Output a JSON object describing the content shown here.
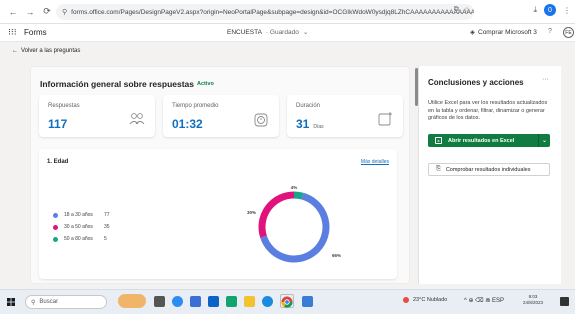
{
  "browser": {
    "back": "←",
    "forward": "→",
    "reload": "⟳",
    "url": "forms.office.com/Pages/DesignPageV2.aspx?origin=NeoPortalPage&subpage=design&id=OCGIkWdoW0ysdjq8LZhCAAAAAAAAAAAAAAAAAAAAAAAAAAAAAAAAAAZAAMKuKHUMzVCSVo0SElz...",
    "profile_initial": "0"
  },
  "app": {
    "name": "Forms",
    "survey_name": "ENCUESTA",
    "save_state": "· Guardado",
    "buy_label": "Comprar Microsoft 3",
    "help": "?",
    "avatar": "FE"
  },
  "back_link": "Volver a las preguntas",
  "overview": {
    "title": "Información general sobre respuestas",
    "status": "Activo",
    "stats": [
      {
        "label": "Respuestas",
        "value": "117",
        "unit": "",
        "icon": "respondents-icon"
      },
      {
        "label": "Tiempo promedio",
        "value": "01:32",
        "unit": "",
        "icon": "timer-icon"
      },
      {
        "label": "Duración",
        "value": "31",
        "unit": "Días",
        "icon": "calendar-icon"
      }
    ]
  },
  "question": {
    "title": "1. Edad",
    "more_details": "Más detalles",
    "options": [
      {
        "label": "18 a 30 años",
        "count": "77",
        "color": "#5b7fe0"
      },
      {
        "label": "30 a 50 años",
        "count": "35",
        "color": "#e0127c"
      },
      {
        "label": "50 a 80 años",
        "count": "5",
        "color": "#1aa58b"
      }
    ]
  },
  "chart_data": {
    "type": "pie",
    "categories": [
      "18 a 30 años",
      "30 a 50 años",
      "50 a 80 años"
    ],
    "values": [
      77,
      35,
      5
    ],
    "data_labels": [
      "66%",
      "30%",
      "4%"
    ]
  },
  "insights": {
    "title": "Conclusiones y acciones",
    "more": "···",
    "description": "Utilice Excel para ver los resultados actualizados en la tabla y ordenar, filtrar, dinamizar o generar gráficos de los datos.",
    "excel_button": "Abrir resultados en Excel",
    "compare_button": "Comprobar resultados individuales"
  },
  "taskbar": {
    "search_placeholder": "Buscar",
    "weather": "23°C  Nublado",
    "tray": "^ ⊕ ⌫ ⋒ ESP",
    "time": "9:03",
    "date": "24/8/2023"
  }
}
